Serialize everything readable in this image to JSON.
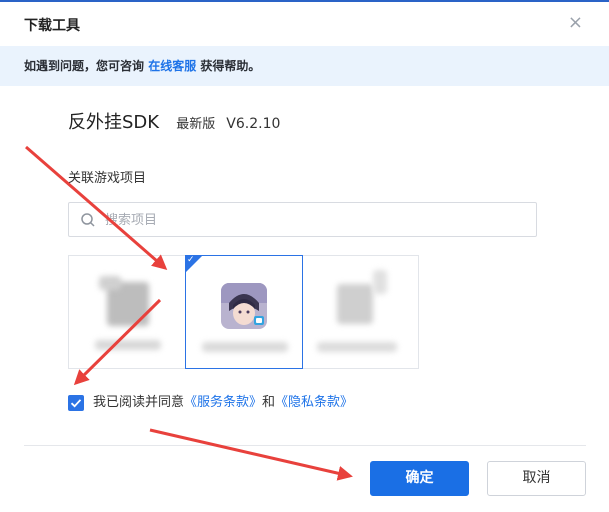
{
  "dialog": {
    "title": "下载工具",
    "close_glyph": "×"
  },
  "notice": {
    "prefix": "如遇到问题，您可咨询",
    "link": "在线客服",
    "suffix": "获得帮助。"
  },
  "product": {
    "name": "反外挂SDK",
    "version_label": "最新版",
    "version": "V6.2.10"
  },
  "games_section": {
    "title": "关联游戏项目",
    "search_placeholder": "搜索项目"
  },
  "agreement": {
    "checked": true,
    "prefix": "我已阅读并同意",
    "terms_link": "《服务条款》",
    "conjunction": "和",
    "privacy_link": "《隐私条款》"
  },
  "buttons": {
    "confirm": "确定",
    "cancel": "取消"
  },
  "colors": {
    "accent": "#1a6fe5",
    "link": "#1e73e8",
    "notice_bg": "#eaf3fd",
    "annotation_arrow": "#e8413c"
  },
  "icons": {
    "close": "close-icon",
    "search": "search-icon",
    "check": "check-icon"
  }
}
